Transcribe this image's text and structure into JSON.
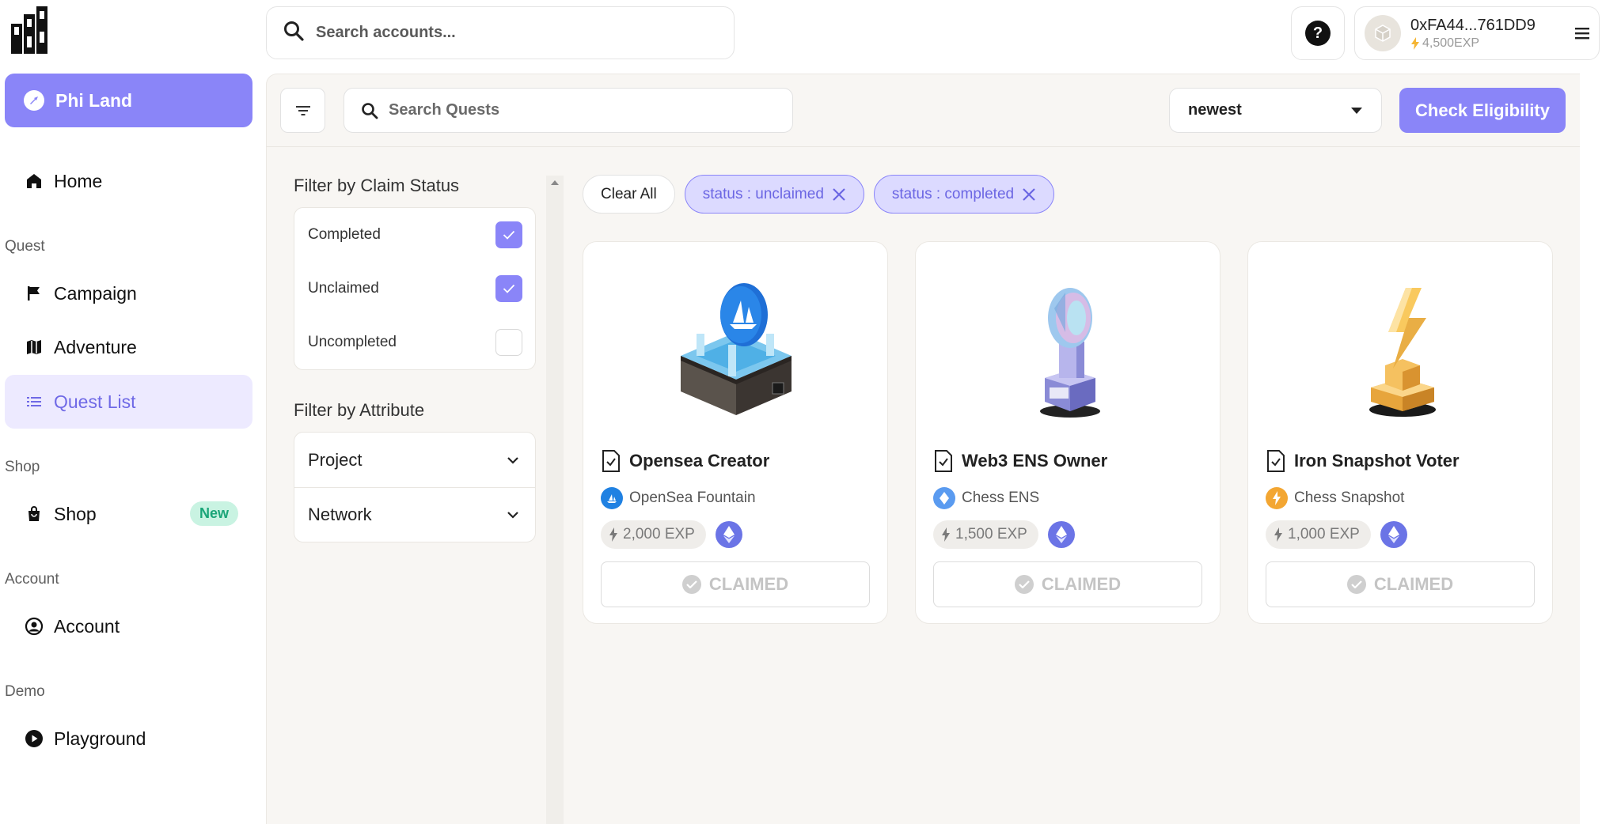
{
  "header": {
    "search_placeholder": "Search accounts...",
    "help_label": "?",
    "account": {
      "address": "0xFA44...761DD9",
      "exp": "4,500EXP"
    }
  },
  "sidebar": {
    "primary": "Phi Land",
    "home": "Home",
    "sections": {
      "quest": "Quest",
      "shop": "Shop",
      "account": "Account",
      "demo": "Demo"
    },
    "items": {
      "campaign": "Campaign",
      "adventure": "Adventure",
      "quest_list": "Quest List",
      "shop": "Shop",
      "shop_badge": "New",
      "account": "Account",
      "playground": "Playground"
    }
  },
  "toolbar": {
    "search_placeholder": "Search Quests",
    "sort_value": "newest",
    "check_button": "Check Eligibility"
  },
  "filters": {
    "claim_title": "Filter by Claim Status",
    "claim_options": [
      {
        "label": "Completed",
        "checked": true
      },
      {
        "label": "Unclaimed",
        "checked": true
      },
      {
        "label": "Uncompleted",
        "checked": false
      }
    ],
    "attr_title": "Filter by Attribute",
    "attr_options": [
      "Project",
      "Network"
    ]
  },
  "chips": {
    "clear": "Clear All",
    "active": [
      "status : unclaimed",
      "status : completed"
    ]
  },
  "cards": [
    {
      "title": "Opensea Creator",
      "source": "OpenSea Fountain",
      "exp": "2,000 EXP",
      "status": "CLAIMED",
      "source_color": "#2081e2"
    },
    {
      "title": "Web3 ENS Owner",
      "source": "Chess ENS",
      "exp": "1,500 EXP",
      "status": "CLAIMED",
      "source_color": "#5a9bf0"
    },
    {
      "title": "Iron Snapshot Voter",
      "source": "Chess Snapshot",
      "exp": "1,000 EXP",
      "status": "CLAIMED",
      "source_color": "#f3a632"
    }
  ],
  "colors": {
    "accent": "#8a85f8",
    "accent_light": "#edeaff",
    "new_badge": "#1aa578"
  }
}
